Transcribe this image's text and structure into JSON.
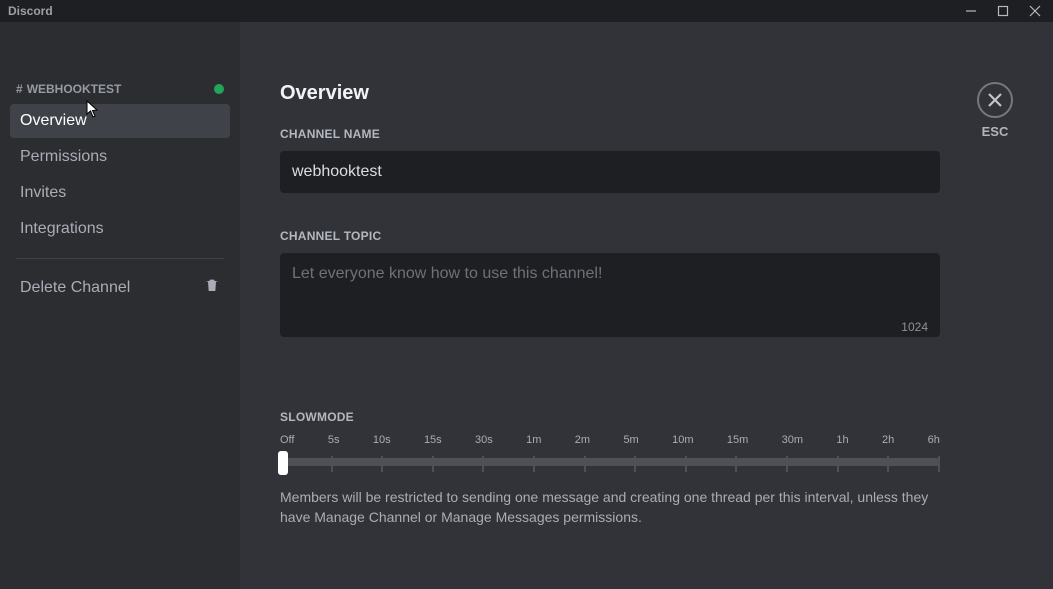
{
  "titlebar": {
    "app_name": "Discord"
  },
  "sidebar": {
    "channel_hash": "#",
    "channel_name": "WEBHOOKTEST",
    "items": [
      {
        "label": "Overview",
        "active": true
      },
      {
        "label": "Permissions",
        "active": false
      },
      {
        "label": "Invites",
        "active": false
      },
      {
        "label": "Integrations",
        "active": false
      }
    ],
    "delete_label": "Delete Channel"
  },
  "close": {
    "esc_label": "ESC"
  },
  "main": {
    "page_title": "Overview",
    "channel_name_label": "CHANNEL NAME",
    "channel_name_value": "webhooktest",
    "channel_topic_label": "CHANNEL TOPIC",
    "channel_topic_placeholder": "Let everyone know how to use this channel!",
    "channel_topic_charcount": "1024",
    "slowmode_label": "SLOWMODE",
    "slowmode_ticks": [
      "Off",
      "5s",
      "10s",
      "15s",
      "30s",
      "1m",
      "2m",
      "5m",
      "10m",
      "15m",
      "30m",
      "1h",
      "2h",
      "6h"
    ],
    "slowmode_help": "Members will be restricted to sending one message and creating one thread per this interval, unless they have Manage Channel or Manage Messages permissions."
  }
}
